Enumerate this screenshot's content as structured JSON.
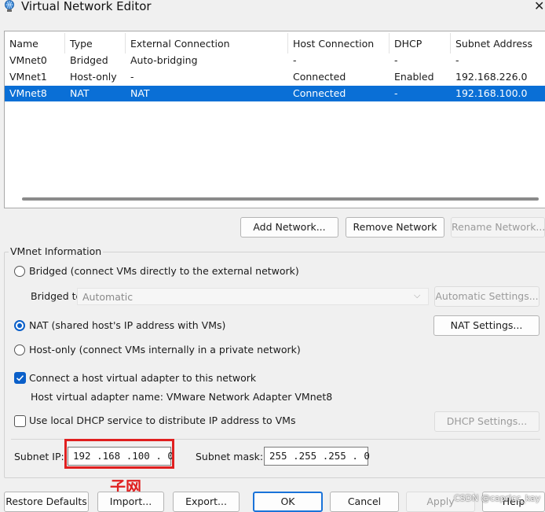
{
  "window": {
    "title": "Virtual Network Editor",
    "close_glyph": "✕",
    "icon": "network-globe-icon"
  },
  "table": {
    "columns": [
      "Name",
      "Type",
      "External Connection",
      "Host Connection",
      "DHCP",
      "Subnet Address"
    ],
    "rows": [
      {
        "name": "VMnet0",
        "type": "Bridged",
        "external": "Auto-bridging",
        "host": "-",
        "dhcp": "-",
        "subnet": "-",
        "selected": false
      },
      {
        "name": "VMnet1",
        "type": "Host-only",
        "external": "-",
        "host": "Connected",
        "dhcp": "Enabled",
        "subnet": "192.168.226.0",
        "selected": false
      },
      {
        "name": "VMnet8",
        "type": "NAT",
        "external": "NAT",
        "host": "Connected",
        "dhcp": "-",
        "subnet": "192.168.100.0",
        "selected": true
      }
    ]
  },
  "network_buttons": {
    "add": "Add Network...",
    "remove": "Remove Network",
    "rename": "Rename Network..."
  },
  "vmnet_info": {
    "label": "VMnet Information",
    "bridged_label": "Bridged (connect VMs directly to the external network)",
    "bridged_to_label": "Bridged to:",
    "bridged_to_value": "Automatic",
    "automatic_settings": "Automatic Settings...",
    "nat_label": "NAT (shared host's IP address with VMs)",
    "nat_settings": "NAT Settings...",
    "hostonly_label": "Host-only (connect VMs internally in a private network)",
    "connect_adapter_label": "Connect a host virtual adapter to this network",
    "adapter_name_text": "Host virtual adapter name: VMware Network Adapter VMnet8",
    "dhcp_label": "Use local DHCP service to distribute IP address to VMs",
    "dhcp_settings": "DHCP Settings...",
    "subnet_ip_label": "Subnet IP:",
    "subnet_ip_value": "192 .168 .100 .  0",
    "subnet_mask_label": "Subnet mask:",
    "subnet_mask_value": "255 .255 .255 .  0",
    "selected_mode": "nat",
    "connect_adapter_checked": true,
    "dhcp_checked": false
  },
  "footer": {
    "restore": "Restore Defaults",
    "import": "Import...",
    "export": "Export...",
    "ok": "OK",
    "cancel": "Cancel",
    "apply": "Apply",
    "help": "Help"
  },
  "overlays": {
    "watermark": "子网",
    "csdn": "CSDN @capricc_kay"
  },
  "colors": {
    "selection": "#0a6fd6",
    "highlight_box": "#e02020",
    "accent": "#0a5fc9"
  }
}
